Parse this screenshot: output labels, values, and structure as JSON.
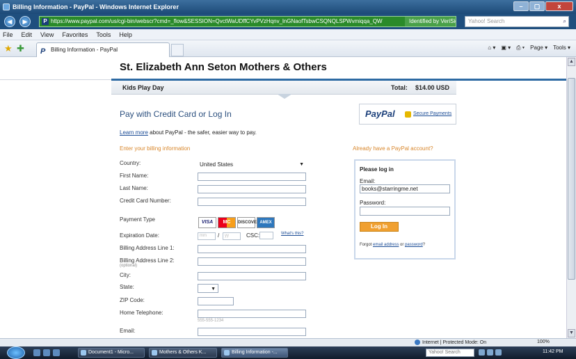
{
  "window": {
    "title": "Billing Information - PayPal - Windows Internet Explorer",
    "controls": [
      "–",
      "▢",
      "x"
    ]
  },
  "address_bar": {
    "url": "https://www.paypal.com/us/cgi-bin/webscr?cmd=_flow&SESSION=QvctWaUDffCYvPVzHqnv_lnGNaofTsbwCSQNQLSPWvmiqqa_QW",
    "identity": "Identified by VeriSign",
    "search_placeholder": "Yahoo! Search"
  },
  "menu": [
    "File",
    "Edit",
    "View",
    "Favorites",
    "Tools",
    "Help"
  ],
  "tab": {
    "label": "Billing Information - PayPal"
  },
  "command_bar": [
    "Page ▾",
    "Tools ▾"
  ],
  "page": {
    "org_name": "St. Elizabeth Ann Seton Mothers & Others",
    "item_name": "Kids Play Day",
    "total_label": "Total:",
    "total_value": "$14.00 USD",
    "heading": "Pay with Credit Card or Log In",
    "paypal_logo": "PayPal",
    "secure_payments": "Secure Payments",
    "learn_more_link": "Learn more",
    "learn_more_text": "about PayPal - the safer, easier way to pay.",
    "billing_heading": "Enter your billing information",
    "labels": {
      "country": "Country:",
      "first_name": "First Name:",
      "last_name": "Last Name:",
      "card_number": "Credit Card Number:",
      "payment_type": "Payment Type",
      "expiration": "Expiration Date:",
      "address1": "Billing Address Line 1:",
      "address2": "Billing Address Line 2:",
      "address2_opt": "(optional)",
      "city": "City:",
      "state": "State:",
      "zip": "ZIP Code:",
      "phone": "Home Telephone:",
      "email": "Email:"
    },
    "country_value": "United States",
    "card_types": [
      "VISA",
      "MC",
      "DISCOVER",
      "AMEX"
    ],
    "exp_month_ph": "mm",
    "exp_year_ph": "yy",
    "exp_sep": "/",
    "csc_label": "CSC:",
    "whats_this": "What's this?",
    "phone_hint": "555-555-1234"
  },
  "login": {
    "heading": "Already have a PayPal account?",
    "title": "Please log in",
    "email_label": "Email:",
    "email_value": "books@starringme.net",
    "password_label": "Password:",
    "button": "Log In",
    "forgot_prefix": "Forgot",
    "forgot_email": "email address",
    "forgot_or": "or",
    "forgot_password": "password",
    "forgot_suffix": "?"
  },
  "status": {
    "zone": "Internet | Protected Mode: On",
    "zoom": "100%"
  },
  "taskbar": {
    "items": [
      "Document1 - Micro...",
      "Mothers & Others K...",
      "Billing Information -..."
    ],
    "search": "Yahoo! Search",
    "clock": "11:42 PM"
  },
  "colors": {
    "accent_blue": "#2d6aa3",
    "orange": "#d8862b",
    "paypal_navy": "#1b3f7a"
  }
}
